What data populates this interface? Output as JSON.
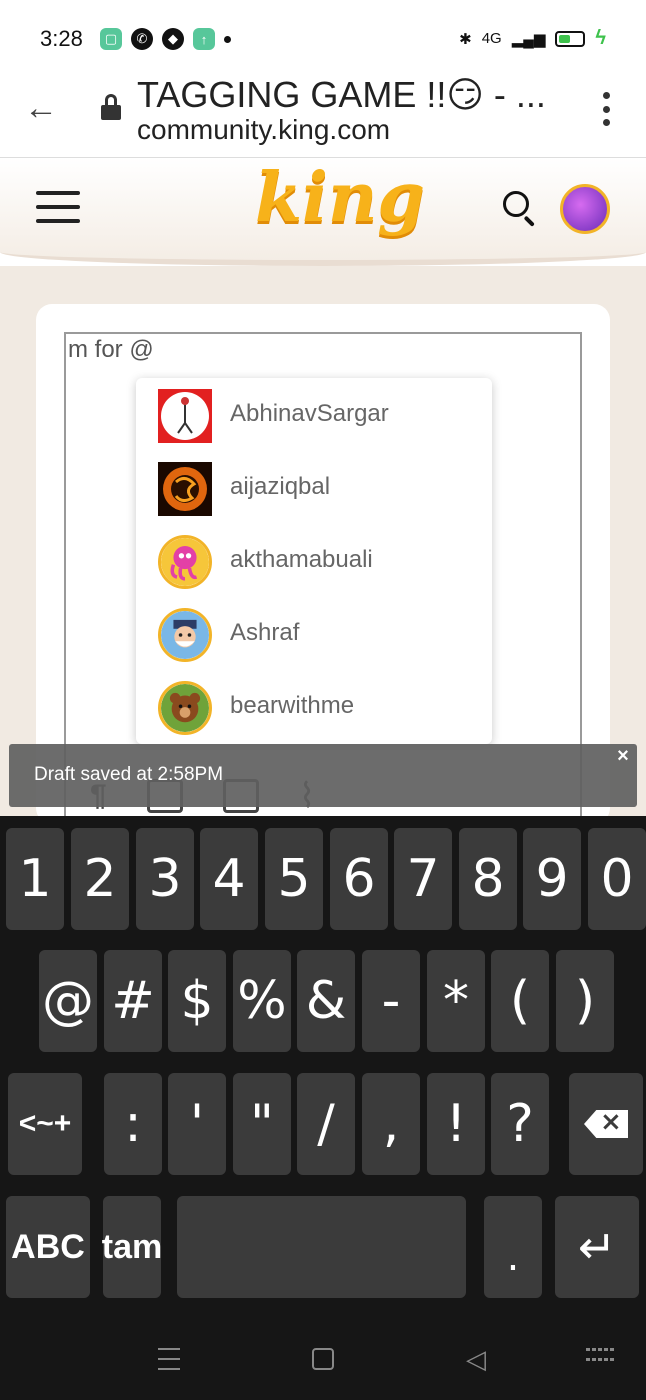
{
  "status_bar": {
    "time": "3:28",
    "network": "4G",
    "battery_percent": 50
  },
  "browser": {
    "tab_title": "TAGGING GAME !!😏 - ...",
    "url": "community.king.com"
  },
  "site_header": {
    "logo_text": "king"
  },
  "editor": {
    "text": "m for @"
  },
  "mentions": [
    {
      "username": "AbhinavSargar",
      "avatar": "stick-figure-avatar"
    },
    {
      "username": "aijaziqbal",
      "avatar": "dragon-avatar"
    },
    {
      "username": "akthamabuali",
      "avatar": "pink-octopus-avatar"
    },
    {
      "username": "Ashraf",
      "avatar": "captain-avatar"
    },
    {
      "username": "bearwithme",
      "avatar": "bear-avatar"
    }
  ],
  "toast": {
    "message": "Draft saved at 2:58PM",
    "close_label": "×"
  },
  "keyboard": {
    "row1": [
      "1",
      "2",
      "3",
      "4",
      "5",
      "6",
      "7",
      "8",
      "9",
      "0"
    ],
    "row2": [
      "@",
      "#",
      "$",
      "%",
      "&",
      "-",
      "*",
      "(",
      ")"
    ],
    "row3": [
      "<~+",
      ":",
      "'",
      "\"",
      "/",
      ",",
      "!",
      "?"
    ],
    "row4": {
      "abc": "ABC",
      "lang": "tam",
      "space": "",
      "period": "."
    }
  },
  "colors": {
    "brand_yellow": "#f7b21a",
    "page_background": "#f1eae2",
    "keyboard_background": "#161616",
    "key_background": "#3b3b3b"
  }
}
